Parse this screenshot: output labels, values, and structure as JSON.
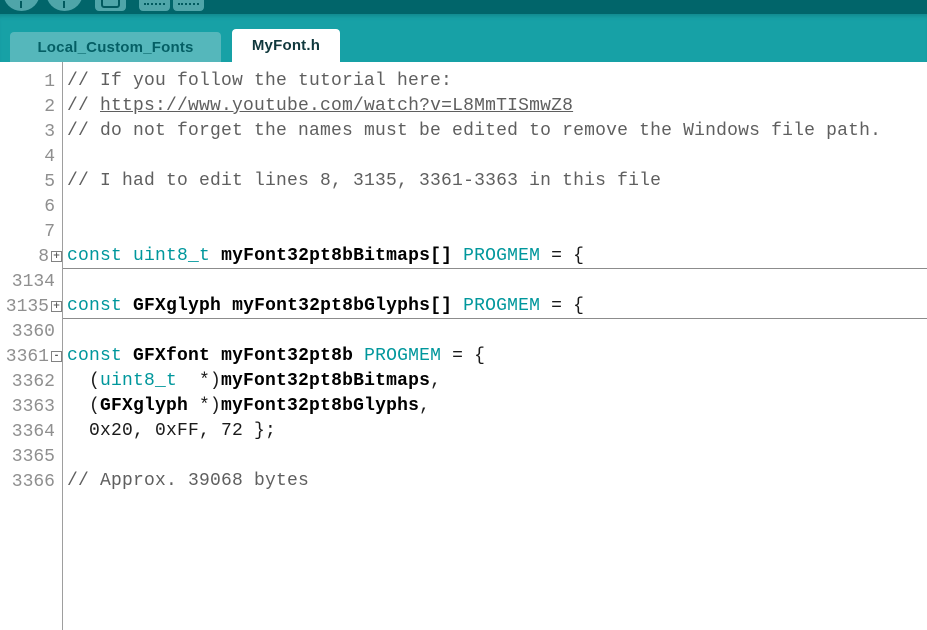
{
  "colors": {
    "toolbar_bg": "#01656a",
    "button_bg": "#4fa5a9",
    "tabbar_bg": "#17a1a6",
    "tab_inactive_bg": "#55b7bb",
    "tab_inactive_text": "#045f65",
    "tab_active_bg": "#ffffff",
    "tab_active_text": "#10383d",
    "keyword": "#00979c",
    "comment": "#5f5f5f",
    "line_number": "#8f8f8f"
  },
  "toolbar": {
    "buttons": [
      {
        "name": "verify"
      },
      {
        "name": "upload"
      },
      {
        "name": "new-sketch"
      },
      {
        "name": "open"
      },
      {
        "name": "save"
      }
    ]
  },
  "tabs": [
    {
      "label": "Local_Custom_Fonts",
      "active": false
    },
    {
      "label": "MyFont.h",
      "active": true
    }
  ],
  "editor": {
    "lines": [
      {
        "num": "1",
        "fold": null,
        "underline": false,
        "segments": [
          {
            "c": "cm",
            "t": "// If you follow the tutorial here:"
          }
        ]
      },
      {
        "num": "2",
        "fold": null,
        "underline": false,
        "segments": [
          {
            "c": "cm",
            "t": "// "
          },
          {
            "c": "link",
            "t": "https://www.youtube.com/watch?v=L8MmTISmwZ8"
          }
        ]
      },
      {
        "num": "3",
        "fold": null,
        "underline": false,
        "segments": [
          {
            "c": "cm",
            "t": "// do not forget the names must be edited to remove the Windows file path."
          }
        ]
      },
      {
        "num": "4",
        "fold": null,
        "underline": false,
        "segments": []
      },
      {
        "num": "5",
        "fold": null,
        "underline": false,
        "segments": [
          {
            "c": "cm",
            "t": "// I had to edit lines 8, 3135, 3361-3363 in this file"
          }
        ]
      },
      {
        "num": "6",
        "fold": null,
        "underline": false,
        "segments": []
      },
      {
        "num": "7",
        "fold": null,
        "underline": false,
        "segments": []
      },
      {
        "num": "8",
        "fold": "+",
        "underline": true,
        "segments": [
          {
            "c": "kw",
            "t": "const"
          },
          {
            "c": "pl",
            "t": " "
          },
          {
            "c": "kw",
            "t": "uint8_t"
          },
          {
            "c": "pl",
            "t": " "
          },
          {
            "c": "id",
            "t": "myFont32pt8bBitmaps[]"
          },
          {
            "c": "pl",
            "t": " "
          },
          {
            "c": "kw",
            "t": "PROGMEM"
          },
          {
            "c": "pl",
            "t": " = {"
          }
        ]
      },
      {
        "num": "3134",
        "fold": null,
        "underline": false,
        "segments": []
      },
      {
        "num": "3135",
        "fold": "+",
        "underline": true,
        "segments": [
          {
            "c": "kw",
            "t": "const"
          },
          {
            "c": "pl",
            "t": " "
          },
          {
            "c": "id",
            "t": "GFXglyph"
          },
          {
            "c": "pl",
            "t": " "
          },
          {
            "c": "id",
            "t": "myFont32pt8bGlyphs[]"
          },
          {
            "c": "pl",
            "t": " "
          },
          {
            "c": "kw",
            "t": "PROGMEM"
          },
          {
            "c": "pl",
            "t": " = {"
          }
        ]
      },
      {
        "num": "3360",
        "fold": null,
        "underline": false,
        "segments": []
      },
      {
        "num": "3361",
        "fold": "-",
        "underline": false,
        "segments": [
          {
            "c": "kw",
            "t": "const"
          },
          {
            "c": "pl",
            "t": " "
          },
          {
            "c": "id",
            "t": "GFXfont"
          },
          {
            "c": "pl",
            "t": " "
          },
          {
            "c": "id",
            "t": "myFont32pt8b"
          },
          {
            "c": "pl",
            "t": " "
          },
          {
            "c": "kw",
            "t": "PROGMEM"
          },
          {
            "c": "pl",
            "t": " = {"
          }
        ]
      },
      {
        "num": "3362",
        "fold": null,
        "underline": false,
        "segments": [
          {
            "c": "pl",
            "t": "  ("
          },
          {
            "c": "kw",
            "t": "uint8_t"
          },
          {
            "c": "pl",
            "t": "  *)"
          },
          {
            "c": "id",
            "t": "myFont32pt8bBitmaps"
          },
          {
            "c": "pl",
            "t": ","
          }
        ]
      },
      {
        "num": "3363",
        "fold": null,
        "underline": false,
        "segments": [
          {
            "c": "pl",
            "t": "  ("
          },
          {
            "c": "id",
            "t": "GFXglyph"
          },
          {
            "c": "pl",
            "t": " *)"
          },
          {
            "c": "id",
            "t": "myFont32pt8bGlyphs"
          },
          {
            "c": "pl",
            "t": ","
          }
        ]
      },
      {
        "num": "3364",
        "fold": null,
        "underline": false,
        "segments": [
          {
            "c": "pl",
            "t": "  0x20, 0xFF, 72 };"
          }
        ]
      },
      {
        "num": "3365",
        "fold": null,
        "underline": false,
        "segments": []
      },
      {
        "num": "3366",
        "fold": null,
        "underline": false,
        "segments": [
          {
            "c": "cm",
            "t": "// Approx. 39068 bytes"
          }
        ]
      }
    ]
  }
}
